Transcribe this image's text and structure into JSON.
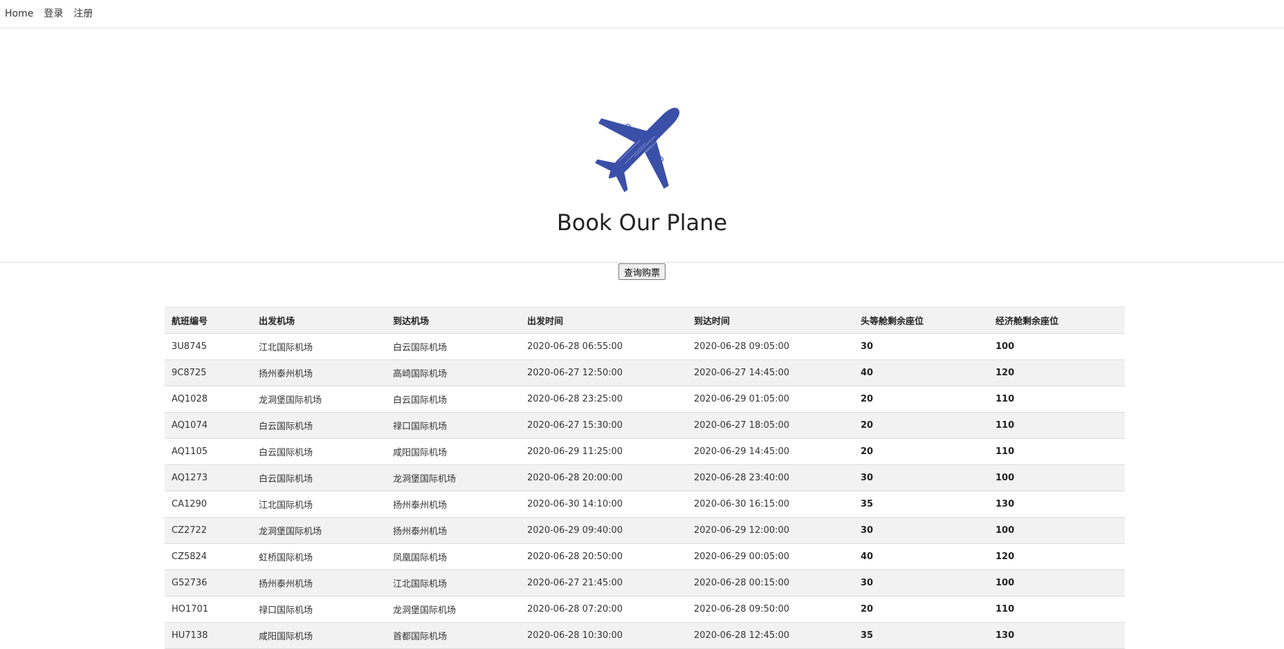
{
  "nav": {
    "home": "Home",
    "login": "登录",
    "register": "注册"
  },
  "hero": {
    "title": "Book Our Plane",
    "icon": "airplane-icon",
    "accent_color": "#3a4fa8"
  },
  "actions": {
    "query_label": "查询购票"
  },
  "table": {
    "headers": [
      "航班编号",
      "出发机场",
      "到达机场",
      "出发时间",
      "到达时间",
      "头等舱剩余座位",
      "经济舱剩余座位"
    ],
    "rows": [
      [
        "3U8745",
        "江北国际机场",
        "白云国际机场",
        "2020-06-28 06:55:00",
        "2020-06-28 09:05:00",
        "30",
        "100"
      ],
      [
        "9C8725",
        "扬州泰州机场",
        "高崎国际机场",
        "2020-06-27 12:50:00",
        "2020-06-27 14:45:00",
        "40",
        "120"
      ],
      [
        "AQ1028",
        "龙洞堡国际机场",
        "白云国际机场",
        "2020-06-28 23:25:00",
        "2020-06-29 01:05:00",
        "20",
        "110"
      ],
      [
        "AQ1074",
        "白云国际机场",
        "禄口国际机场",
        "2020-06-27 15:30:00",
        "2020-06-27 18:05:00",
        "20",
        "110"
      ],
      [
        "AQ1105",
        "白云国际机场",
        "咸阳国际机场",
        "2020-06-29 11:25:00",
        "2020-06-29 14:45:00",
        "20",
        "110"
      ],
      [
        "AQ1273",
        "白云国际机场",
        "龙洞堡国际机场",
        "2020-06-28 20:00:00",
        "2020-06-28 23:40:00",
        "30",
        "100"
      ],
      [
        "CA1290",
        "江北国际机场",
        "扬州泰州机场",
        "2020-06-30 14:10:00",
        "2020-06-30 16:15:00",
        "35",
        "130"
      ],
      [
        "CZ2722",
        "龙洞堡国际机场",
        "扬州泰州机场",
        "2020-06-29 09:40:00",
        "2020-06-29 12:00:00",
        "30",
        "100"
      ],
      [
        "CZ5824",
        "虹桥国际机场",
        "凤凰国际机场",
        "2020-06-28 20:50:00",
        "2020-06-29 00:05:00",
        "40",
        "120"
      ],
      [
        "G52736",
        "扬州泰州机场",
        "江北国际机场",
        "2020-06-27 21:45:00",
        "2020-06-28 00:15:00",
        "30",
        "100"
      ],
      [
        "HO1701",
        "禄口国际机场",
        "龙洞堡国际机场",
        "2020-06-28 07:20:00",
        "2020-06-28 09:50:00",
        "20",
        "110"
      ],
      [
        "HU7138",
        "咸阳国际机场",
        "首都国际机场",
        "2020-06-28 10:30:00",
        "2020-06-28 12:45:00",
        "35",
        "130"
      ]
    ]
  }
}
